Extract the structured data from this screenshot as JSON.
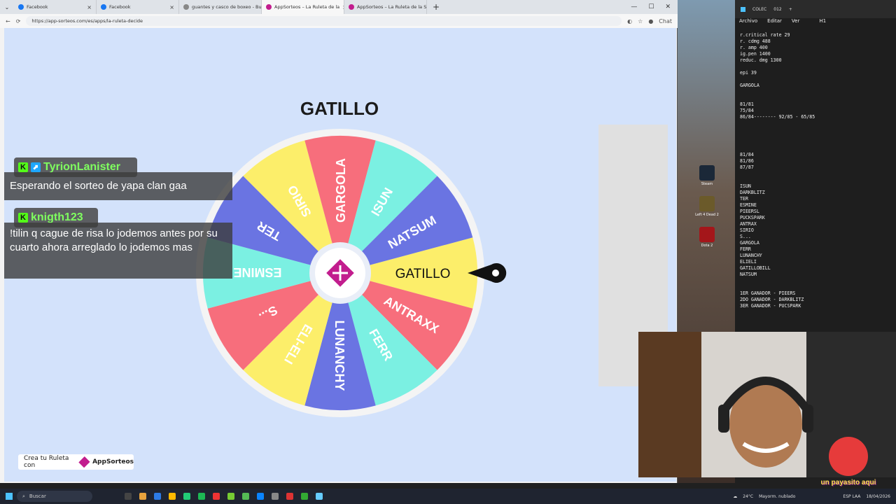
{
  "browser": {
    "tabs": [
      {
        "label": "Facebook",
        "color": "#1877f2",
        "active": false
      },
      {
        "label": "Facebook",
        "color": "#1877f2",
        "active": false
      },
      {
        "label": "guantes y casco de boxeo - Busca",
        "color": "#888888",
        "active": false
      },
      {
        "label": "AppSorteos – La Ruleta de la",
        "color": "#c21d8e",
        "active": true
      },
      {
        "label": "AppSorteos – La Ruleta de la Sue",
        "color": "#c21d8e",
        "active": false
      }
    ],
    "url": "https://app-sorteos.com/es/apps/la-ruleta-decide",
    "chat_label": "Chat"
  },
  "wheel": {
    "winner_title": "GATILLO",
    "segments": [
      {
        "label": "GATILLO",
        "color": "#fcee6a"
      },
      {
        "label": "ANTRAXX",
        "color": "#f76e7c"
      },
      {
        "label": "FERR",
        "color": "#7bf0e2"
      },
      {
        "label": "LUNANCHY",
        "color": "#6a74e2"
      },
      {
        "label": "ELI-ELI",
        "color": "#fcee6a"
      },
      {
        "label": "S...",
        "color": "#f76e7c"
      },
      {
        "label": "ESMINE",
        "color": "#7bf0e2"
      },
      {
        "label": "TER",
        "color": "#6a74e2"
      },
      {
        "label": "SIRIO",
        "color": "#fcee6a"
      },
      {
        "label": "GARGOLA",
        "color": "#f76e7c"
      },
      {
        "label": "ISUN",
        "color": "#7bf0e2"
      },
      {
        "label": "NATSUM",
        "color": "#6a74e2"
      }
    ],
    "center_color": "#c21d8e"
  },
  "promo": {
    "text": "Crea tu Ruleta con",
    "brand": "AppSorteos"
  },
  "chat": [
    {
      "user": "TyrionLanister",
      "message": "Esperando el sorteo de yapa clan gaa"
    },
    {
      "user": "knigth123",
      "message": "!tilin q cague de risa lo jodemos antes por su cuarto ahora arreglado lo jodemos mas"
    }
  ],
  "desktop_icons": [
    {
      "label": "Steam",
      "color": "#1b2838"
    },
    {
      "label": "Left 4 Dead 2",
      "color": "#6b5a2a"
    },
    {
      "label": "Dota 2",
      "color": "#a4161a"
    }
  ],
  "notepad": {
    "tab": "COLEC",
    "tab2": "012",
    "menu": [
      "Archivo",
      "Editar",
      "Ver"
    ],
    "heading": "H1",
    "lines": [
      "r.critical rate 29",
      "r. cdmg 488",
      "r. amp 400",
      "ig.pen 1400",
      "reduc. dmg 1300",
      "",
      "epi 39",
      "",
      "GARGOLA",
      "",
      "",
      "81/81",
      "75/84",
      "86/84-------- 92/85 - 65/85",
      "",
      "",
      "",
      "",
      "",
      "81/84",
      "81/86",
      "87/87",
      "",
      "",
      "ISUN",
      "DARKBLITZ",
      "TER",
      "ESMINE",
      "PIEERSL",
      "PUCKSPARK",
      "ANTRAX",
      "SIRIO",
      "S...",
      "GARGOLA",
      "FERR",
      "LUNANCHY",
      "ELIELI",
      "GATILLOBILL",
      "NATSUM",
      "",
      "",
      "1ER GANADOR - PIEERS",
      "2DO GANADOR - DARKBLITZ",
      "3ER GANADOR - PUCSPARK"
    ]
  },
  "webcam": {
    "caption": "un payasito aqui"
  },
  "taskbar": {
    "search_placeholder": "Buscar",
    "weather": "24°C",
    "weather_desc": "Mayorm. nublado",
    "lang": "ESP LAA",
    "date": "18/04/2026"
  }
}
